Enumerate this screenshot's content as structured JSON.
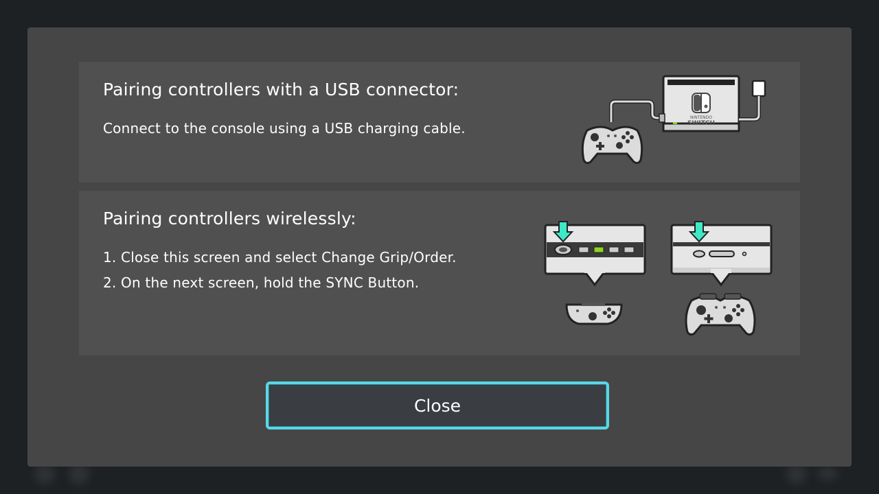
{
  "dialog": {
    "usb_section": {
      "title": "Pairing controllers with a USB connector:",
      "description": "Connect to the console using a USB charging cable.",
      "dock_logo_line1": "NINTENDO",
      "dock_logo_line2": "SWITCH"
    },
    "wireless_section": {
      "title": "Pairing controllers wirelessly:",
      "step1": "1. Close this screen and select Change Grip/Order.",
      "step2": "2. On the next screen, hold the SYNC Button."
    },
    "close_label": "Close"
  },
  "colors": {
    "accent_cyan": "#5ad6e6",
    "arrow_green": "#3fe8c6",
    "led_green": "#8fd321"
  },
  "icons": [
    "usb-dock-illustration",
    "pro-controller-icon",
    "joycon-sync-illustration",
    "pro-controller-sync-illustration",
    "sync-arrow-icon"
  ]
}
